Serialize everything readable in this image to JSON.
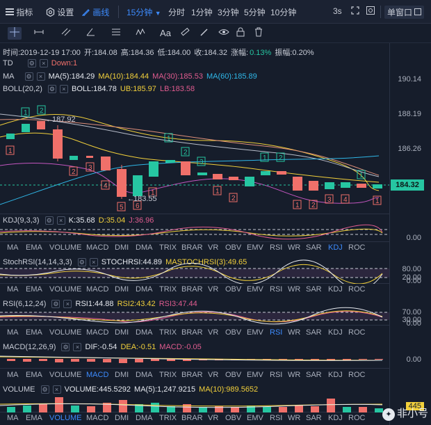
{
  "topbar": {
    "indicator_label": "指标",
    "settings_label": "设置",
    "draw_label": "画线",
    "interval_selected": "15分钟",
    "intervals": [
      "分时",
      "1分钟",
      "3分钟",
      "5分钟",
      "10分钟"
    ],
    "refresh": "3s",
    "window_mode": "单窗口"
  },
  "toolbar": {
    "text_tool": "Aa"
  },
  "info": {
    "time": "时间:2019-12-19 17:00",
    "open": "开:184.08",
    "high": "高:184.36",
    "low": "低:184.00",
    "close": "收:184.32",
    "change_label": "涨幅:",
    "change": "0.13%",
    "amp": "振幅:0.20%"
  },
  "main": {
    "td_label": "TD",
    "td_value": "Down:1",
    "ma_label": "MA",
    "ma5": "MA(5):184.29",
    "ma10": "MA(10):184.44",
    "ma30": "MA(30):185.53",
    "ma60": "MA(60):185.89",
    "boll_label": "BOLL(20,2)",
    "boll": "BOLL:184.78",
    "ub": "UB:185.97",
    "lb": "LB:183.58",
    "high_mark": "187.92",
    "low_mark": "183.55",
    "price_ticks": [
      "190.14",
      "188.19",
      "186.26",
      "184.32"
    ],
    "current_price": "184.32"
  },
  "kdj": {
    "label": "KDJ(9,3,3)",
    "k": "K:35.68",
    "d": "D:35.04",
    "j": "J:36.96",
    "tick": "0.00"
  },
  "stochrsi": {
    "label": "StochRSI(14,14,3,3)",
    "v1": "STOCHRSI:44.89",
    "v2": "MASTOCHRSI(3):49.65",
    "ticks": [
      "80.00",
      "20.00",
      "0.00"
    ]
  },
  "rsi": {
    "label": "RSI(6,12,24)",
    "r1": "RSI1:44.88",
    "r2": "RSI2:43.42",
    "r3": "RSI3:47.44",
    "ticks": [
      "70.00",
      "30.00",
      "0.00"
    ]
  },
  "macd": {
    "label": "MACD(12,26,9)",
    "dif": "DIF:-0.54",
    "dea": "DEA:-0.51",
    "macd": "MACD:-0.05",
    "tick": "0.00"
  },
  "volume": {
    "label": "VOLUME",
    "vol": "VOLUME:445.5292",
    "ma5": "MA(5):1,247.9215",
    "ma10": "MA(10):989.5652",
    "tick": "445"
  },
  "indicator_tabs": [
    "MA",
    "EMA",
    "VOLUME",
    "MACD",
    "DMI",
    "DMA",
    "TRIX",
    "BRAR",
    "VR",
    "OBV",
    "EMV",
    "RSI",
    "WR",
    "SAR",
    "KDJ",
    "ROC"
  ],
  "watermark": "非小号",
  "colors": {
    "up": "#26c6a2",
    "down": "#f0706a",
    "ma5": "#e6e9ef",
    "ma10": "#f2d03b",
    "ma30": "#e05c8f",
    "ma60": "#2fb7e8",
    "accent": "#3d8bfd"
  }
}
